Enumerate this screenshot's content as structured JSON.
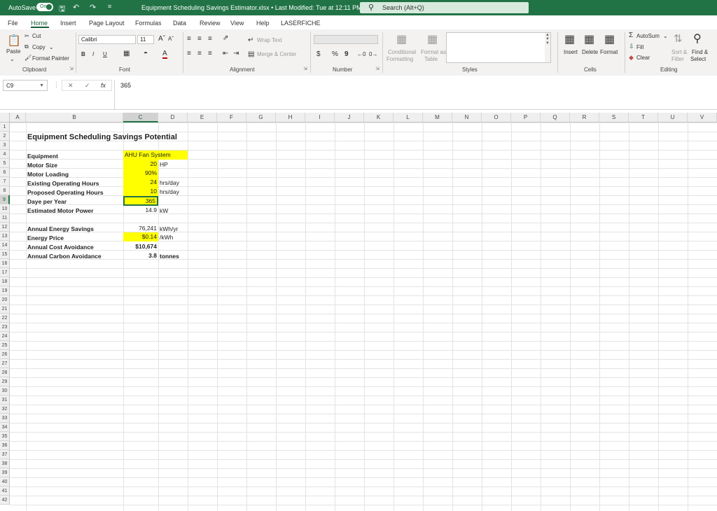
{
  "titlebar": {
    "autosave_label": "AutoSave",
    "autosave_state": "On",
    "document_title": "Equipment Scheduling Savings Estimator.xlsx • Last Modified: Tue at 12:11 PM",
    "search_placeholder": "Search (Alt+Q)"
  },
  "menu": {
    "tabs": [
      "File",
      "Home",
      "Insert",
      "Page Layout",
      "Formulas",
      "Data",
      "Review",
      "View",
      "Help",
      "LASERFICHE"
    ],
    "active": "Home"
  },
  "ribbon": {
    "clipboard": {
      "paste": "Paste",
      "cut": "Cut",
      "copy": "Copy",
      "format_painter": "Format Painter",
      "label": "Clipboard"
    },
    "font": {
      "name": "Calibri",
      "size": "11",
      "label": "Font",
      "bold": "B",
      "italic": "I",
      "underline": "U"
    },
    "alignment": {
      "wrap_text": "Wrap Text",
      "merge_center": "Merge & Center",
      "label": "Alignment"
    },
    "number": {
      "currency": "$",
      "percent": "%",
      "comma": "9",
      "label": "Number"
    },
    "styles": {
      "conditional_formatting_1": "Conditional",
      "conditional_formatting_2": "Formatting",
      "format_as_table_1": "Format as",
      "format_as_table_2": "Table",
      "label": "Styles"
    },
    "cells": {
      "insert": "Insert",
      "delete": "Delete",
      "format": "Format",
      "label": "Cells"
    },
    "editing": {
      "autosum": "AutoSum",
      "fill": "Fill",
      "clear": "Clear",
      "sort_filter_1": "Sort &",
      "sort_filter_2": "Filter",
      "find_select_1": "Find &",
      "find_select_2": "Select",
      "label": "Editing"
    }
  },
  "formula_bar": {
    "name_box": "C9",
    "value": "365"
  },
  "columns": [
    "A",
    "B",
    "C",
    "D",
    "E",
    "F",
    "G",
    "H",
    "I",
    "J",
    "K",
    "L",
    "M",
    "N",
    "O",
    "P",
    "Q",
    "R",
    "S",
    "T",
    "U",
    "V"
  ],
  "rows": [
    "1",
    "2",
    "3",
    "4",
    "5",
    "6",
    "7",
    "8",
    "9",
    "10",
    "11",
    "12",
    "13",
    "14",
    "15",
    "16",
    "17",
    "18",
    "19",
    "20",
    "21",
    "22",
    "23",
    "24",
    "25",
    "26",
    "27",
    "28",
    "29",
    "30",
    "31",
    "32",
    "33",
    "34",
    "35",
    "36",
    "37",
    "38",
    "39",
    "40",
    "41",
    "42"
  ],
  "sheet": {
    "title": "Equipment Scheduling Savings Potential",
    "inputs": [
      {
        "label": "Equipment",
        "value": "AHU Fan System",
        "unit": ""
      },
      {
        "label": "Motor Size",
        "value": "20",
        "unit": "HP"
      },
      {
        "label": "Motor Loading",
        "value": "90%",
        "unit": ""
      },
      {
        "label": "Existing Operating Hours",
        "value": "24",
        "unit": "hrs/day"
      },
      {
        "label": "Proposed Operating Hours",
        "value": "10",
        "unit": "hrs/day"
      },
      {
        "label": "Daye per Year",
        "value": "365",
        "unit": ""
      },
      {
        "label": "Estimated Motor Power",
        "value": "14.9",
        "unit": "kW"
      }
    ],
    "results": [
      {
        "label": "Annual Energy Savings",
        "value": "76,241",
        "unit": "kWh/yr"
      },
      {
        "label": "Energy Price",
        "value": "$0.14",
        "unit": "/kWh"
      },
      {
        "label": "Annual Cost Avoidance",
        "value": "$10,674",
        "unit": ""
      },
      {
        "label": "Annual Carbon Avoidance",
        "value": "3.8",
        "unit": "tonnes"
      }
    ]
  }
}
